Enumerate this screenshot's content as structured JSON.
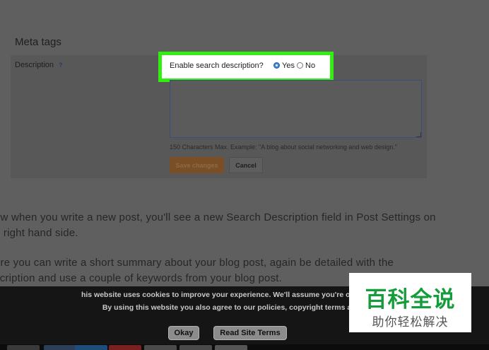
{
  "meta_tags": {
    "section_title": "Meta tags",
    "description_label": "Description",
    "help_icon": "?",
    "enable_question": "Enable search description?",
    "option_yes": "Yes",
    "option_no": "No",
    "selected_option": "Yes",
    "hint": "150 Characters Max. Example: \"A blog about social networking and web design.\"",
    "save_label": "Save changes",
    "cancel_label": "Cancel"
  },
  "article": {
    "paragraph1_line1": "ow when you write a new post, you'll see a new Search Description field in Post Settings on",
    "paragraph1_line2": "e right hand side.",
    "paragraph2_line1": "ere you can write a short summary about your blog post, again be detailed with the",
    "paragraph2_line2": "scription and use a couple of keywords from your blog post."
  },
  "cookie_bar": {
    "line1": "his website uses cookies to improve your experience. We'll assume you're ok with this, but",
    "line2": "By using this website you also agree to our policies, copyright terms and othe",
    "ok_label": "Okay",
    "terms_label": "Read Site Terms"
  },
  "watermark": {
    "title": "百科全说",
    "subtitle": "助你轻松解决"
  },
  "colors": {
    "highlight_border": "#33ee11",
    "radio_selected": "#3d86d6",
    "save_button": "#7a4f26",
    "watermark_green": "#159c3b"
  }
}
